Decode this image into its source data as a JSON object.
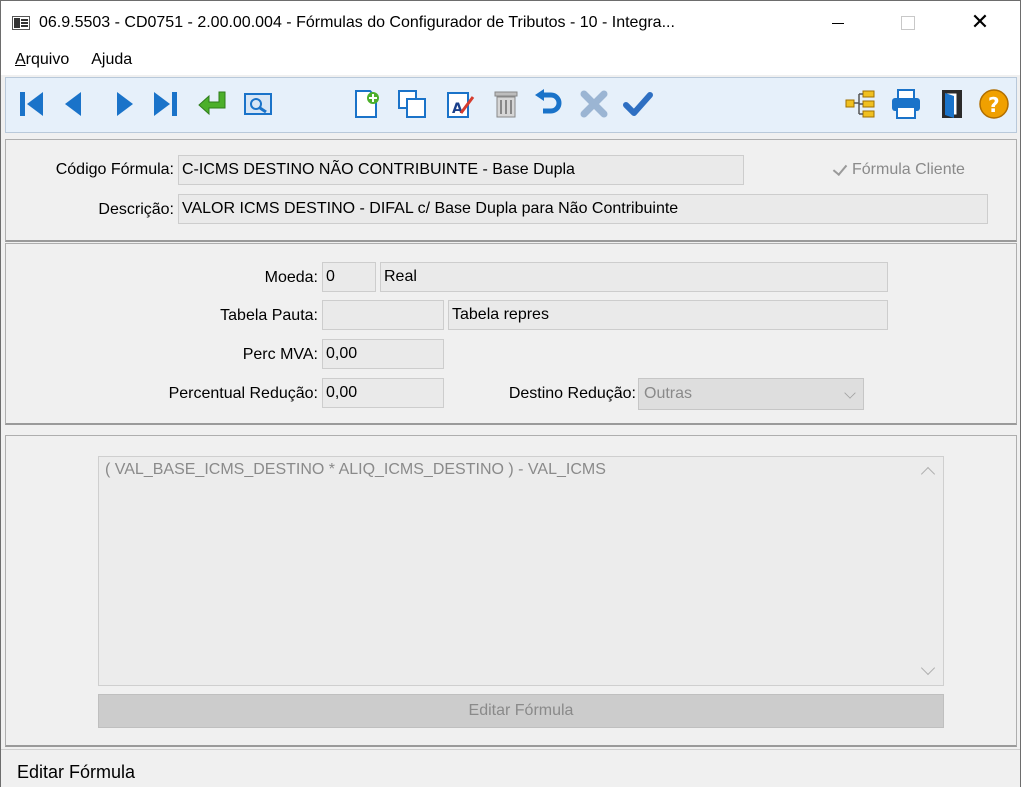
{
  "window": {
    "title": "06.9.5503 - CD0751 - 2.00.00.004 - Fórmulas do Configurador de Tributos - 10 - Integra..."
  },
  "menu": {
    "arquivo_accel": "A",
    "arquivo_rest": "rquivo",
    "ajuda_pre": "A",
    "ajuda_accel": "j",
    "ajuda_rest": "uda"
  },
  "toolbar": {
    "icons": [
      "first-icon",
      "previous-icon",
      "next-icon",
      "last-icon",
      "enter-icon",
      "search-icon",
      "new-icon",
      "copy-icon",
      "edit-icon",
      "delete-icon",
      "undo-icon",
      "cancel-icon",
      "confirm-icon",
      "tree-icon",
      "print-icon",
      "exit-icon",
      "help-icon"
    ]
  },
  "header": {
    "codigo_label": "Código Fórmula:",
    "codigo_value": "C-ICMS DESTINO NÃO CONTRIBUINTE - Base Dupla",
    "formula_cliente_label": "Fórmula Cliente",
    "formula_cliente_checked": true,
    "descricao_label": "Descrição:",
    "descricao_value": "VALOR ICMS DESTINO - DIFAL c/ Base Dupla para Não Contribuinte"
  },
  "params": {
    "moeda_label": "Moeda:",
    "moeda_code": "0",
    "moeda_name": "Real",
    "tabela_label": "Tabela Pauta:",
    "tabela_code": "",
    "tabela_name": "Tabela repres",
    "mva_label": "Perc MVA:",
    "mva_value": "0,00",
    "reducao_label": "Percentual Redução:",
    "reducao_value": "0,00",
    "destino_label": "Destino Redução:",
    "destino_value": "Outras"
  },
  "formula": {
    "text": "( VAL_BASE_ICMS_DESTINO * ALIQ_ICMS_DESTINO ) - VAL_ICMS",
    "edit_button": "Editar Fórmula"
  },
  "status": {
    "text": "Editar Fórmula"
  },
  "colors": {
    "toolbar_blue": "#1a73c9",
    "enter_green": "#4caf2a",
    "help_orange": "#f0a000"
  }
}
